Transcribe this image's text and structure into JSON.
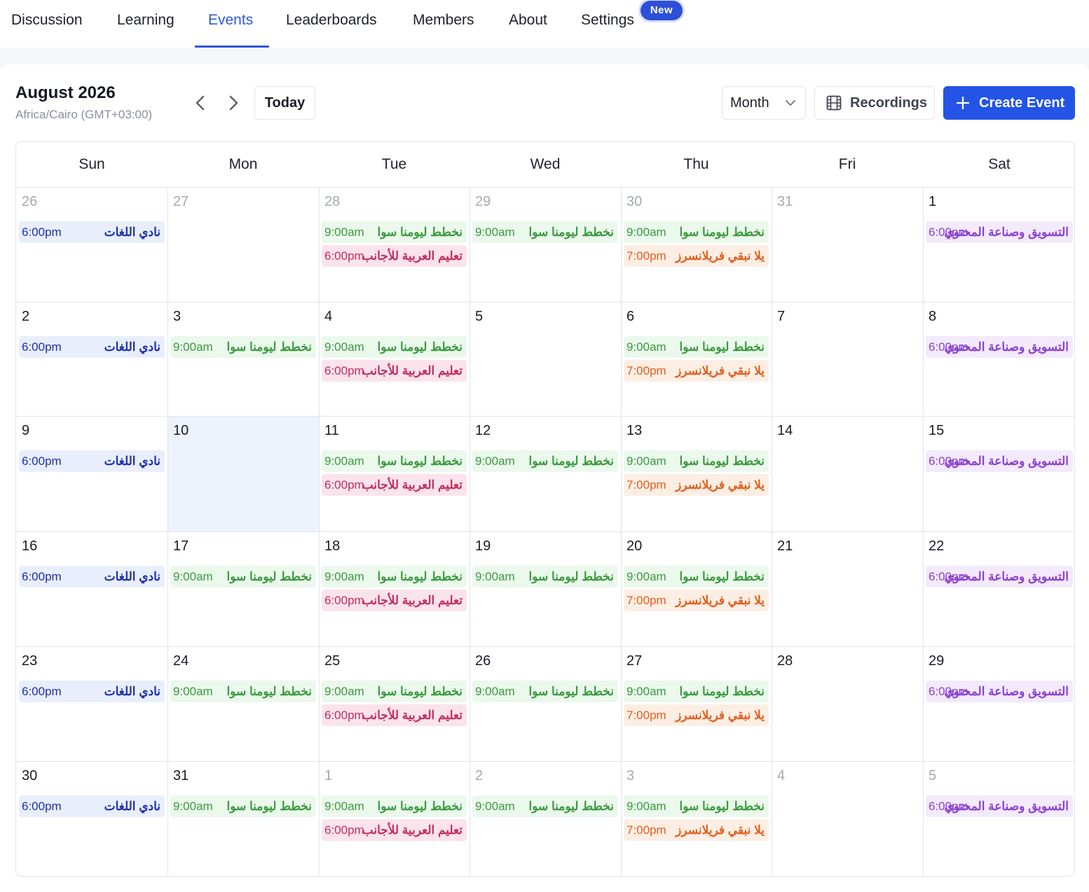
{
  "nav": {
    "tabs": [
      {
        "key": "discussion",
        "label": "Discussion"
      },
      {
        "key": "learning",
        "label": "Learning"
      },
      {
        "key": "events",
        "label": "Events",
        "active": true
      },
      {
        "key": "leaderboards",
        "label": "Leaderboards"
      },
      {
        "key": "members",
        "label": "Members"
      },
      {
        "key": "about",
        "label": "About"
      },
      {
        "key": "settings",
        "label": "Settings"
      }
    ],
    "new_badge": "New"
  },
  "header": {
    "title": "August 2026",
    "timezone": "Africa/Cairo (GMT+03:00)",
    "prev_icon": "chevron-left-icon",
    "next_icon": "chevron-right-icon",
    "today_label": "Today",
    "view_label": "Month",
    "recordings_label": "Recordings",
    "create_label": "Create Event"
  },
  "colors": {
    "accent": "#2454e6",
    "active_tab": "#2d58d8",
    "today_bg": "#eef2fd"
  },
  "calendar": {
    "weekdays": [
      "Sun",
      "Mon",
      "Tue",
      "Wed",
      "Thu",
      "Fri",
      "Sat"
    ],
    "today": "10",
    "categories": {
      "lang": {
        "bg": "#e8eefc",
        "fg": "#1c2fb0"
      },
      "plan": {
        "bg": "#ebf8ec",
        "fg": "#3a9a3e"
      },
      "arabic": {
        "bg": "#fbe3ec",
        "fg": "#c22d5e"
      },
      "free": {
        "bg": "#fdeee4",
        "fg": "#e25d1b"
      },
      "content": {
        "bg": "#f3eafc",
        "fg": "#8a3fd1"
      }
    },
    "events": {
      "lang": {
        "time": "6:00pm",
        "name": "نادي اللغات"
      },
      "plan": {
        "time": "9:00am",
        "name": "نخطط ليومنا سوا"
      },
      "arabic": {
        "time": "6:00pm",
        "name": "تعليم العربية للأجانب"
      },
      "free": {
        "time": "7:00pm",
        "name": "يلا نبقي فريلانسرز"
      },
      "content": {
        "time": "6:00pm",
        "name": "التسويق وصناعة المحتوي"
      }
    },
    "weeks": [
      [
        {
          "day": "26",
          "muted": true,
          "ev": [
            "lang"
          ]
        },
        {
          "day": "27",
          "muted": true,
          "ev": []
        },
        {
          "day": "28",
          "muted": true,
          "ev": [
            "plan",
            "arabic"
          ]
        },
        {
          "day": "29",
          "muted": true,
          "ev": [
            "plan"
          ]
        },
        {
          "day": "30",
          "muted": true,
          "ev": [
            "plan",
            "free"
          ]
        },
        {
          "day": "31",
          "muted": true,
          "ev": []
        },
        {
          "day": "1",
          "ev": [
            "content"
          ]
        }
      ],
      [
        {
          "day": "2",
          "ev": [
            "lang"
          ]
        },
        {
          "day": "3",
          "ev": [
            "plan"
          ]
        },
        {
          "day": "4",
          "ev": [
            "plan",
            "arabic"
          ]
        },
        {
          "day": "5",
          "ev": []
        },
        {
          "day": "6",
          "ev": [
            "plan",
            "free"
          ]
        },
        {
          "day": "7",
          "ev": []
        },
        {
          "day": "8",
          "ev": [
            "content"
          ]
        }
      ],
      [
        {
          "day": "9",
          "ev": [
            "lang"
          ]
        },
        {
          "day": "10",
          "today": true,
          "ev": []
        },
        {
          "day": "11",
          "ev": [
            "plan",
            "arabic"
          ]
        },
        {
          "day": "12",
          "ev": [
            "plan"
          ]
        },
        {
          "day": "13",
          "ev": [
            "plan",
            "free"
          ]
        },
        {
          "day": "14",
          "ev": []
        },
        {
          "day": "15",
          "ev": [
            "content"
          ]
        }
      ],
      [
        {
          "day": "16",
          "ev": [
            "lang"
          ]
        },
        {
          "day": "17",
          "ev": [
            "plan"
          ]
        },
        {
          "day": "18",
          "ev": [
            "plan",
            "arabic"
          ]
        },
        {
          "day": "19",
          "ev": [
            "plan"
          ]
        },
        {
          "day": "20",
          "ev": [
            "plan",
            "free"
          ]
        },
        {
          "day": "21",
          "ev": []
        },
        {
          "day": "22",
          "ev": [
            "content"
          ]
        }
      ],
      [
        {
          "day": "23",
          "ev": [
            "lang"
          ]
        },
        {
          "day": "24",
          "ev": [
            "plan"
          ]
        },
        {
          "day": "25",
          "ev": [
            "plan",
            "arabic"
          ]
        },
        {
          "day": "26",
          "ev": [
            "plan"
          ]
        },
        {
          "day": "27",
          "ev": [
            "plan",
            "free"
          ]
        },
        {
          "day": "28",
          "ev": []
        },
        {
          "day": "29",
          "ev": [
            "content"
          ]
        }
      ],
      [
        {
          "day": "30",
          "ev": [
            "lang"
          ]
        },
        {
          "day": "31",
          "ev": [
            "plan"
          ]
        },
        {
          "day": "1",
          "muted": true,
          "ev": [
            "plan",
            "arabic"
          ]
        },
        {
          "day": "2",
          "muted": true,
          "ev": [
            "plan"
          ]
        },
        {
          "day": "3",
          "muted": true,
          "ev": [
            "plan",
            "free"
          ]
        },
        {
          "day": "4",
          "muted": true,
          "ev": []
        },
        {
          "day": "5",
          "muted": true,
          "ev": [
            "content"
          ]
        }
      ]
    ]
  }
}
